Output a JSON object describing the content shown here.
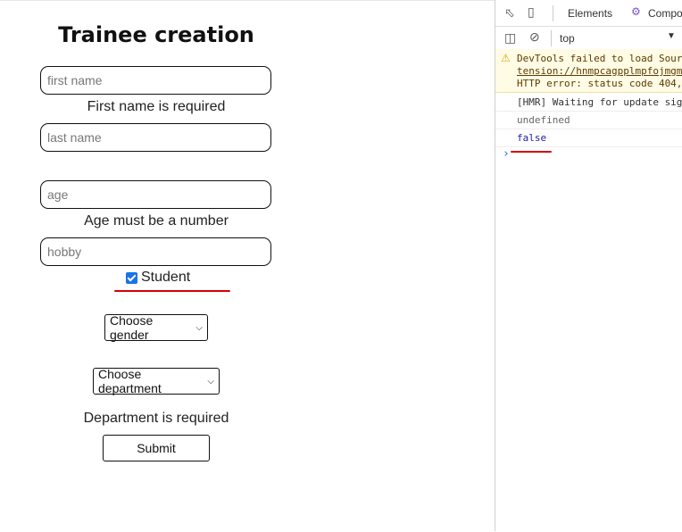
{
  "form": {
    "title": "Trainee creation",
    "first_name_placeholder": "first name",
    "first_name_error": "First name is required",
    "last_name_placeholder": "last name",
    "age_placeholder": "age",
    "age_error": "Age must be a number",
    "hobby_placeholder": "hobby",
    "student_label": "Student",
    "student_checked": true,
    "gender_select": "Choose gender",
    "department_select": "Choose department",
    "department_error": "Department is required",
    "submit_label": "Submit"
  },
  "devtools": {
    "tabs": [
      "Elements",
      "Compo"
    ],
    "context": "top",
    "warning_lines": [
      "DevTools failed to load Sour",
      "tension://hnmpcagpplmpfojmgm",
      "HTTP error: status code 404,"
    ],
    "logs": [
      "[HMR] Waiting for update sig",
      "undefined",
      "false"
    ],
    "prompt": "›",
    "colors": {
      "false_value": "#1a1aa6",
      "warning_bg": "#fffbe5",
      "checkbox": "#1a73e8"
    }
  }
}
